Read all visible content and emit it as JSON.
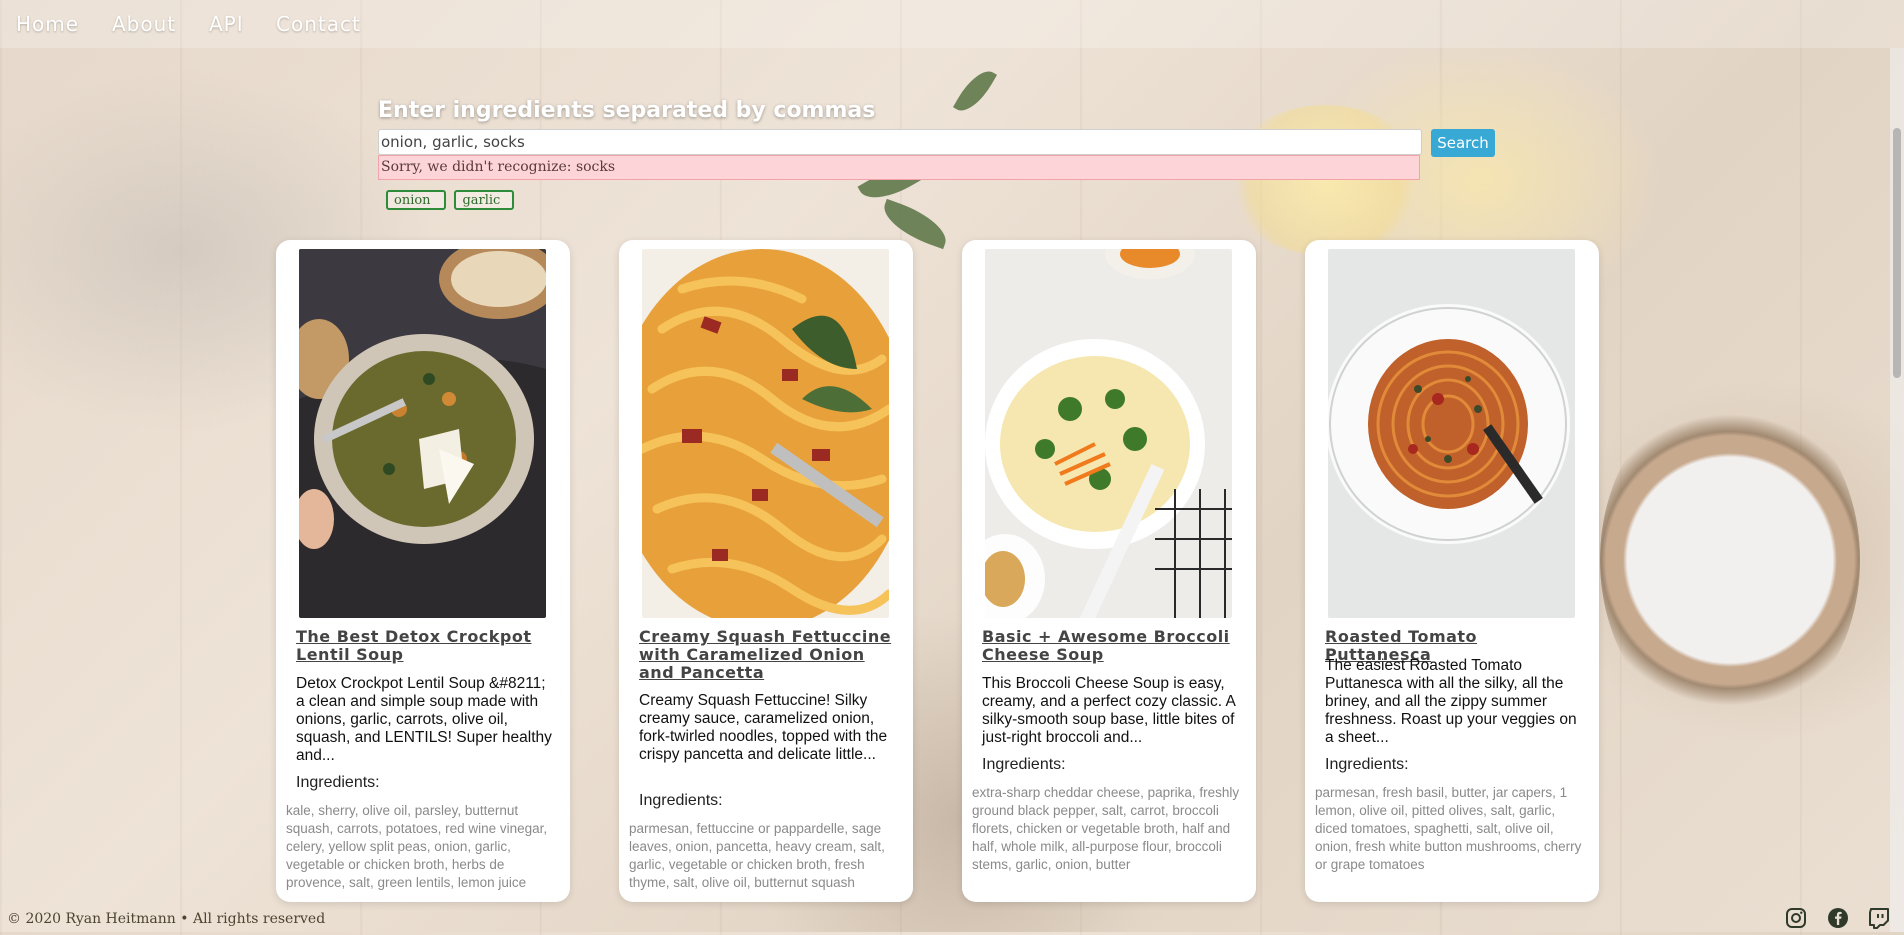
{
  "nav": {
    "items": [
      {
        "label": "Home"
      },
      {
        "label": "About"
      },
      {
        "label": "API"
      },
      {
        "label": "Contact"
      }
    ]
  },
  "search": {
    "prompt": "Enter ingredients separated by commas",
    "value": "onion, garlic, socks",
    "button_label": "Search",
    "error": "Sorry, we didn't recognize: socks",
    "chips": [
      "onion",
      "garlic"
    ]
  },
  "recipes": [
    {
      "title": "The Best Detox Crockpot Lentil Soup",
      "description": "Detox Crockpot Lentil Soup &#8211; a clean and simple soup made with onions, garlic, carrots, olive oil, squash, and LENTILS! Super healthy and...",
      "ingredients_label": "Ingredients:",
      "ingredients": "kale, sherry, olive oil, parsley, butternut squash, carrots, potatoes, red wine vinegar, celery, yellow split peas, onion, garlic, vegetable or chicken broth, herbs de provence, salt, green lentils, lemon juice"
    },
    {
      "title": "Creamy Squash Fettuccine with Caramelized Onion and Pancetta",
      "description": "Creamy Squash Fettuccine! Silky creamy sauce, caramelized onion, fork-twirled noodles, topped with the crispy pancetta and delicate little...",
      "ingredients_label": "Ingredients:",
      "ingredients": "parmesan, fettuccine or pappardelle, sage leaves, onion, pancetta, heavy cream, salt, garlic, vegetable or chicken broth, fresh thyme, salt, olive oil, butternut squash"
    },
    {
      "title": "Basic + Awesome Broccoli Cheese Soup",
      "description": "This Broccoli Cheese Soup is easy, creamy, and a perfect cozy classic. A silky-smooth soup base, little bites of just-right broccoli and...",
      "ingredients_label": "Ingredients:",
      "ingredients": "extra-sharp cheddar cheese, paprika, freshly ground black pepper, salt, carrot, broccoli florets, chicken or vegetable broth, half and half, whole milk, all-purpose flour, broccoli stems, garlic, onion, butter"
    },
    {
      "title": "Roasted Tomato Puttanesca",
      "description": "The easiest Roasted Tomato Puttanesca with all the silky, all the briney, and all the zippy summer freshness. Roast up your veggies on a sheet...",
      "ingredients_label": "Ingredients:",
      "ingredients": "parmesan, fresh basil, butter, jar capers, 1 lemon, olive oil, pitted olives, salt, garlic, diced tomatoes, spaghetti, salt, olive oil, onion, fresh white button mushrooms, cherry or grape tomatoes"
    }
  ],
  "footer": {
    "copyright": "© 2020 Ryan Heitmann • All rights reserved",
    "social_icons": [
      "instagram-icon",
      "facebook-icon",
      "twitch-icon"
    ]
  },
  "colors": {
    "search_button": "#37a9d4",
    "error_bg": "#fdd4d7",
    "chip_border": "#2e8b3a"
  }
}
